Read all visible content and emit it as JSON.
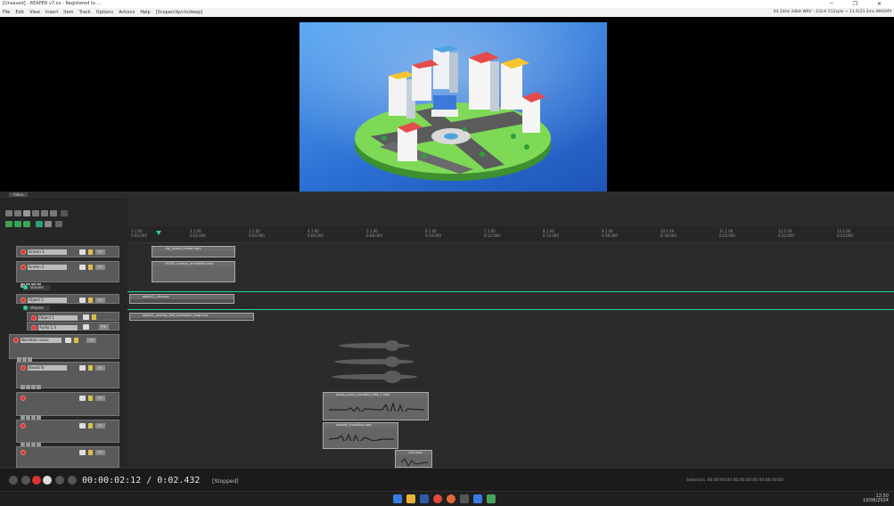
{
  "window": {
    "title": "[Unsaved] - REAPER v7.xx - Registered to ...",
    "controls": "─ ❐ ✕"
  },
  "menu": {
    "items": [
      "File",
      "Edit",
      "View",
      "Insert",
      "Item",
      "Track",
      "Options",
      "Actions",
      "Help",
      "[Scope/clip/ctx/keep]"
    ],
    "stats": "44.1kHz 24bit WAV : 2/2ch 512spls ~ 11.6/23.2ms WASAPI"
  },
  "docker": {
    "tab_label": "Video"
  },
  "ruler": {
    "ticks": [
      {
        "bar": "1.1.00",
        "time": "0:00.000"
      },
      {
        "bar": "2.1.00",
        "time": "0:02.000"
      },
      {
        "bar": "3.1.00",
        "time": "0:04.000"
      },
      {
        "bar": "4.1.00",
        "time": "0:06.000"
      },
      {
        "bar": "5.1.00",
        "time": "0:08.000"
      },
      {
        "bar": "6.1.00",
        "time": "0:10.000"
      },
      {
        "bar": "7.1.00",
        "time": "0:12.000"
      },
      {
        "bar": "8.1.00",
        "time": "0:14.000"
      },
      {
        "bar": "9.1.00",
        "time": "0:16.000"
      },
      {
        "bar": "10.1.00",
        "time": "0:18.000"
      },
      {
        "bar": "11.1.00",
        "time": "0:20.000"
      },
      {
        "bar": "12.1.00",
        "time": "0:22.000"
      },
      {
        "bar": "13.1.00",
        "time": "0:24.000"
      }
    ]
  },
  "tracks": {
    "t1": {
      "name": "Screen 1"
    },
    "t2": {
      "name": "Screen 2"
    },
    "t3": {
      "name": "Object 2"
    },
    "t4": {
      "name": "Object 1"
    },
    "t5": {
      "name": "Audio 1.0"
    },
    "t6": {
      "name": "Narration voice"
    },
    "t7": {
      "name": "Sound fx"
    },
    "fx_label": "FX",
    "env_label": "Volume"
  },
  "items": {
    "i1": "city_scene_render.mp4",
    "i2": "HOTEL_overlay_animation.mov",
    "i3": "object2_clip.mov",
    "i4": "object1_overlay_text_animation_loop.mov",
    "i5": "audio_voice_narration_take_2.wav",
    "i6": "whoosh_transition.wav",
    "i7": "click.wav"
  },
  "transport": {
    "timecode": "00:00:02:12 / 0:02.432",
    "state": "[Stopped]",
    "selection": "Selection: 00:00:00:00   00:00:00:00   00:00:00:00"
  },
  "taskbar": {
    "time": "12:50",
    "date": "10/06/2024"
  }
}
